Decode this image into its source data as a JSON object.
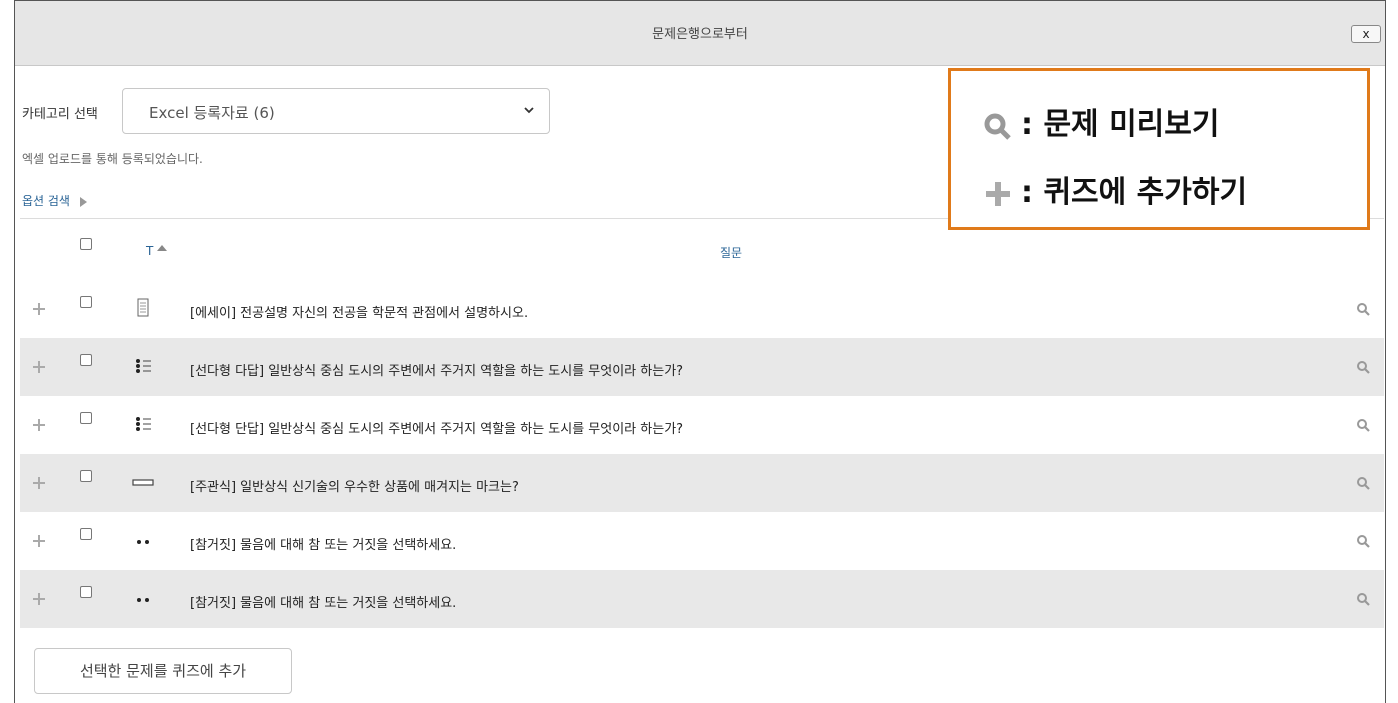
{
  "dialog": {
    "title": "문제은행으로부터",
    "close_label": "x"
  },
  "category": {
    "label": "카테고리 선택",
    "selected": "Excel 등록자료 (6)",
    "info": "엑셀 업로드를 통해 등록되었습니다.",
    "option_search": "옵션 검색"
  },
  "table": {
    "headers": {
      "type": "T",
      "question": "질문"
    },
    "rows": [
      {
        "type_icon": "essay-icon",
        "text": "[에세이] 전공설명   자신의 전공을 학문적 관점에서 설명하시오."
      },
      {
        "type_icon": "multichoice-icon",
        "text": "[선다형 다답] 일반상식   중심 도시의 주변에서 주거지 역할을 하는 도시를 무엇이라 하는가?"
      },
      {
        "type_icon": "multichoice-icon",
        "text": "[선다형 단답] 일반상식   중심 도시의 주변에서 주거지 역할을 하는 도시를 무엇이라 하는가?"
      },
      {
        "type_icon": "short-answer-icon",
        "text": "[주관식] 일반상식   신기술의 우수한 상품에 매겨지는 마크는?"
      },
      {
        "type_icon": "truefalse-icon",
        "text": "[참거짓]   물음에 대해 참 또는 거짓을 선택하세요."
      },
      {
        "type_icon": "truefalse-icon",
        "text": "[참거짓]   물음에 대해 참 또는 거짓을 선택하세요."
      }
    ]
  },
  "add_button": "선택한 문제를 퀴즈에 추가",
  "legend": {
    "preview_label": ": 문제 미리보기",
    "add_label": ": 퀴즈에 추가하기"
  },
  "colors": {
    "legend_border": "#e07a1a",
    "link": "#2a6496",
    "row_shade": "#e8e8e8"
  }
}
